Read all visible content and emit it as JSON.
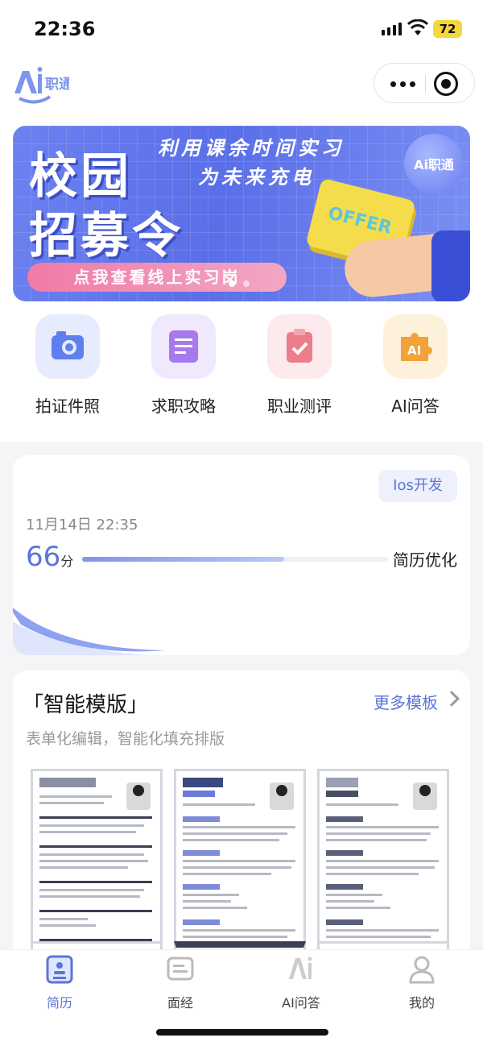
{
  "status_bar": {
    "time": "22:36",
    "battery": "72"
  },
  "header": {
    "logo_text": "Ai职通"
  },
  "banner": {
    "title_line1": "校园",
    "title_line2": "招募令",
    "subtitle_line1": "利用课余时间实习",
    "subtitle_line2": "为未来充电",
    "badge_text": "Ai职通",
    "card_text": "OFFER",
    "button_label": "点我查看线上实习岗"
  },
  "quick_actions": [
    {
      "label": "拍证件照",
      "icon": "camera-icon",
      "bg": "#e6ecfd",
      "color": "#5f7ff0"
    },
    {
      "label": "求职攻略",
      "icon": "document-icon",
      "bg": "#f0e8fd",
      "color": "#a779ee"
    },
    {
      "label": "职业测评",
      "icon": "clipboard-check-icon",
      "bg": "#fdeaec",
      "color": "#ee7d8b"
    },
    {
      "label": "AI问答",
      "icon": "puzzle-ai-icon",
      "bg": "#fdf1dc",
      "color": "#f3a23a"
    }
  ],
  "resume_card": {
    "tag": "Ios开发",
    "date": "11月14日  22:35",
    "score": "66",
    "score_unit": "分",
    "score_progress": 0.66,
    "action_label": "简历优化"
  },
  "templates": {
    "title": "「智能模版」",
    "more_label": "更多模板",
    "subtitle": "表单化编辑，智能化填充排版"
  },
  "tabs": [
    {
      "label": "简历",
      "icon": "resume-icon",
      "active": true
    },
    {
      "label": "面经",
      "icon": "interview-icon",
      "active": false
    },
    {
      "label": "AI问答",
      "icon": "ai-icon",
      "active": false
    },
    {
      "label": "我的",
      "icon": "profile-icon",
      "active": false
    }
  ],
  "colors": {
    "accent": "#5b75d8",
    "banner": "#5a6ee8",
    "pink_button": "#f07aa8"
  }
}
